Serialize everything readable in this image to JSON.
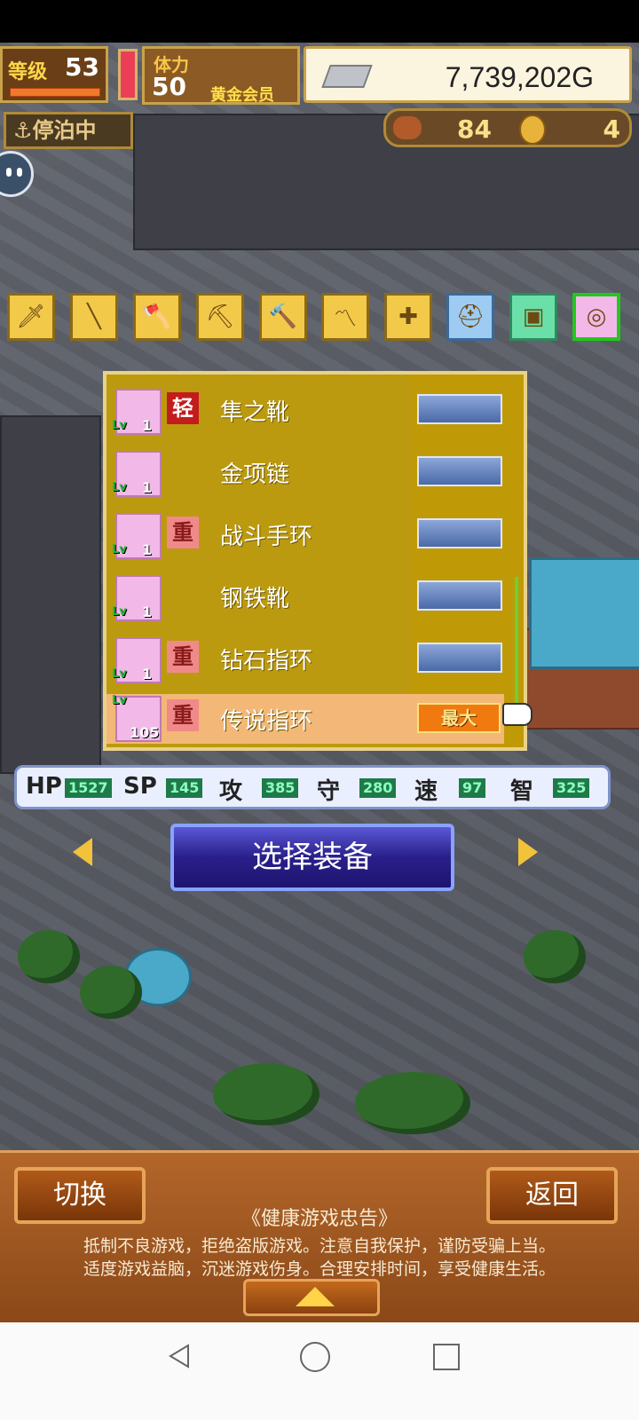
{
  "hud": {
    "level_label": "等级",
    "level": "53",
    "stamina_label": "体力",
    "stamina": "50",
    "vip_label": "黄金会员",
    "gold": "7,739,202G",
    "dock_status": "停泊中",
    "food": "84",
    "medals": "4"
  },
  "categories": [
    {
      "icon": "sword-icon",
      "glyph": "🗡"
    },
    {
      "icon": "staff-icon",
      "glyph": "╲"
    },
    {
      "icon": "axe-icon",
      "glyph": "🪓"
    },
    {
      "icon": "pickaxe-icon",
      "glyph": "⛏"
    },
    {
      "icon": "hammer-icon",
      "glyph": "🔨"
    },
    {
      "icon": "whip-icon",
      "glyph": "〽"
    },
    {
      "icon": "crossbow-icon",
      "glyph": "✚"
    },
    {
      "icon": "helmet-icon",
      "glyph": "⛑"
    },
    {
      "icon": "armor-icon",
      "glyph": "▣"
    },
    {
      "icon": "accessory-icon",
      "glyph": "◎"
    }
  ],
  "items": [
    {
      "name": "隼之靴",
      "tag": "轻",
      "lv": "1",
      "icon": "boots-icon"
    },
    {
      "name": "金项链",
      "tag": "",
      "lv": "1",
      "icon": "necklace-icon"
    },
    {
      "name": "战斗手环",
      "tag": "重",
      "lv": "1",
      "icon": "bracelet-icon"
    },
    {
      "name": "钢铁靴",
      "tag": "",
      "lv": "1",
      "icon": "steel-boots-icon"
    },
    {
      "name": "钻石指环",
      "tag": "重",
      "lv": "1",
      "icon": "diamond-ring-icon"
    },
    {
      "name": "传说指环",
      "tag": "重",
      "lv": "105",
      "icon": "legend-ring-icon",
      "badge": "最大"
    }
  ],
  "lv_label": "Lv",
  "stats": {
    "hp_label": "HP",
    "hp": "1527",
    "sp_label": "SP",
    "sp": "145",
    "atk_label": "攻",
    "atk": "385",
    "def_label": "守",
    "def": "280",
    "spd_label": "速",
    "spd": "97",
    "int_label": "智",
    "int": "325"
  },
  "select_button": "选择装备",
  "bottom": {
    "switch_button": "切换",
    "back_button": "返回",
    "notice_title": "《健康游戏忠告》",
    "notice_line1": "抵制不良游戏，拒绝盗版游戏。注意自我保护，谨防受骗上当。",
    "notice_line2": "适度游戏益脑，沉迷游戏伤身。合理安排时间，享受健康生活。"
  }
}
